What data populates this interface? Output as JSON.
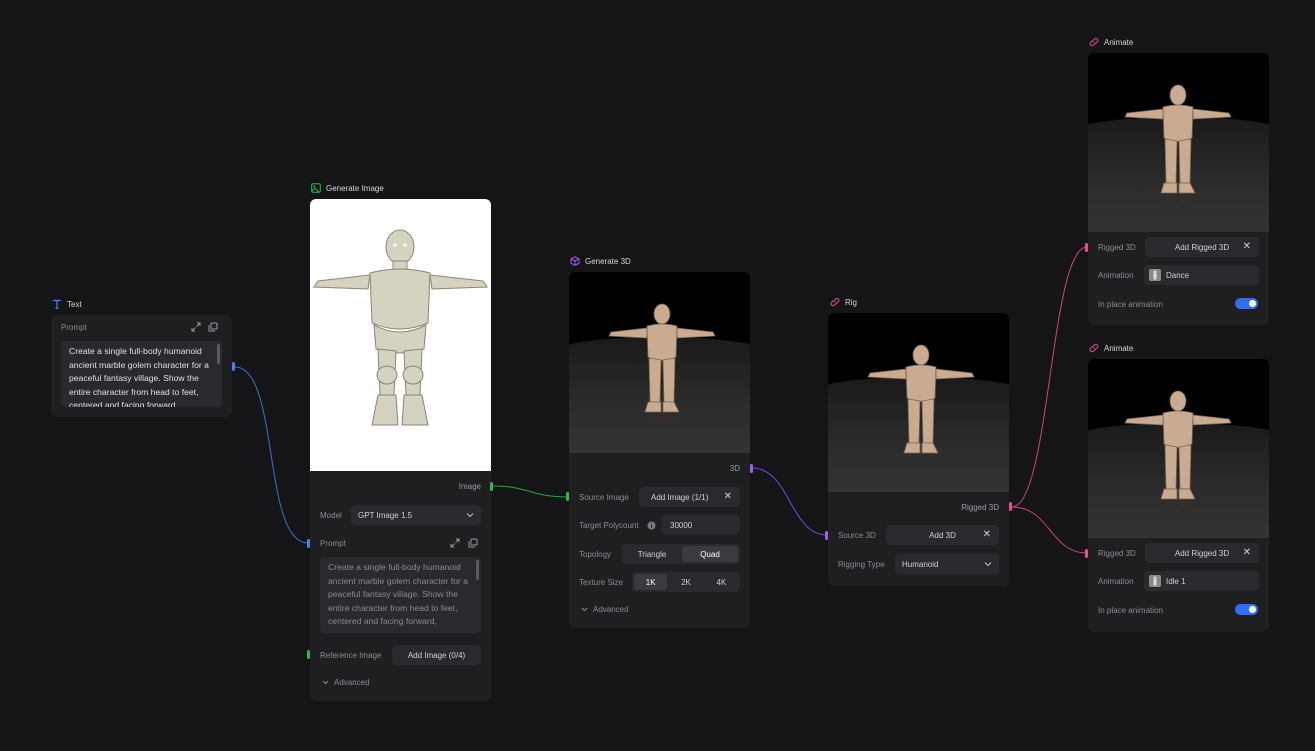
{
  "text_node": {
    "title": "Text",
    "prompt_label": "Prompt",
    "prompt_text": "Create a single full-body humanoid ancient marble golem character for a peaceful fantasy village. Show the entire character from head to feet, centered and facing forward,"
  },
  "generate_image_node": {
    "title": "Generate Image",
    "output_label": "Image",
    "model_label": "Model",
    "model_value": "GPT Image 1.5",
    "prompt_label": "Prompt",
    "prompt_text": "Create a single full-body humanoid ancient marble golem character for a peaceful fantasy village. Show the entire character from head to feet, centered and facing forward,",
    "reference_label": "Reference Image",
    "reference_button": "Add Image (0/4)",
    "advanced_label": "Advanced"
  },
  "generate_3d_node": {
    "title": "Generate 3D",
    "output_label": "3D",
    "source_image_label": "Source Image",
    "source_image_value": "Add Image (1/1)",
    "polycount_label": "Target Polycount",
    "polycount_value": "30000",
    "topology_label": "Topology",
    "topology_options": [
      "Triangle",
      "Quad"
    ],
    "topology_selected": "Quad",
    "texture_label": "Texture Size",
    "texture_options": [
      "1K",
      "2K",
      "4K"
    ],
    "texture_selected": "1K",
    "advanced_label": "Advanced"
  },
  "rig_node": {
    "title": "Rig",
    "output_label": "Rigged 3D",
    "source_label": "Source 3D",
    "source_value": "Add 3D",
    "rigging_type_label": "Rigging Type",
    "rigging_type_value": "Humanoid"
  },
  "animate_nodes": [
    {
      "title": "Animate",
      "rigged_label": "Rigged 3D",
      "rigged_value": "Add Rigged 3D",
      "animation_label": "Animation",
      "animation_value": "Dance",
      "inplace_label": "In place animation",
      "inplace_on": true
    },
    {
      "title": "Animate",
      "rigged_label": "Rigged 3D",
      "rigged_value": "Add Rigged 3D",
      "animation_label": "Animation",
      "animation_value": "Idle 1",
      "inplace_label": "In place animation",
      "inplace_on": true
    }
  ],
  "colors": {
    "background": "#151518",
    "node": "#1f1f22",
    "text_port": "#4d7cf0",
    "image_port": "#2fb84a",
    "model3d_port": "#a45cf0",
    "rig_port": "#e0508c",
    "toggle_on": "#2f6ff0"
  },
  "icons": {
    "text": "text-t-icon",
    "image": "image-icon",
    "cube": "cube-icon",
    "rig": "bandage-icon",
    "expand": "expand-icon",
    "copy": "copy-icon",
    "close": "close-icon",
    "chevron": "chevron-down-icon",
    "info": "info-icon"
  }
}
